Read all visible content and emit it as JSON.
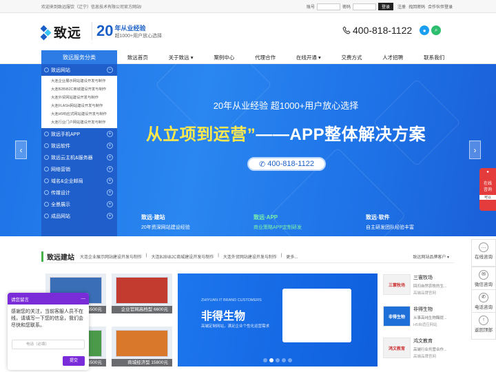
{
  "topbar": {
    "welcome": "欢迎来到致远服饮（辽宁）信息技术有限公司官方网站!",
    "user_label": "账号",
    "pass_label": "密码",
    "login_button": "登录",
    "links": [
      "注册",
      "找回密码",
      "合作伙伴登录"
    ]
  },
  "header": {
    "logo_text": "致远",
    "slogan_big": "20",
    "slogan_line1": "年从业经验",
    "slogan_line2": "超1000+用户放心选择",
    "phone": "400-818-1122"
  },
  "nav": {
    "category_label": "致远服务分类",
    "items": [
      "致远首页",
      "关于致远",
      "案例中心",
      "代理合作",
      "在线开通",
      "交费方式",
      "人才招聘",
      "联系我们"
    ]
  },
  "sidebar": {
    "first": "致远网站",
    "sub_items": [
      "大连企业展示网站建设开发与制作",
      "大连B2B\\B2C商城建设开发与制作",
      "大连外贸网站建设开发与制作",
      "大连FLASH网站建设开发与制作",
      "大连H5响应式网站建设开发与制作",
      "大连行业门户网站建设开发与制作"
    ],
    "items": [
      "致远手机APP",
      "致远软件",
      "致远云主机&服务器",
      "网络营销",
      "域名&企业邮局",
      "传媒设计",
      "全景展示",
      "成品网站"
    ]
  },
  "banner": {
    "subtitle": "20年从业经验    超1000+用户放心选择",
    "head_a": "从立项到运营”",
    "head_b": "——APP整体解决方案",
    "phone": "400-818-1122",
    "features": [
      {
        "title": "致远·建站",
        "desc": "20年资深网站建设经验"
      },
      {
        "title": "致远·APP",
        "desc": "商业策略APP定制研发"
      },
      {
        "title": "致远·软件",
        "desc": "自主研发团队经验丰富"
      }
    ]
  },
  "section": {
    "title": "致远建站",
    "links": [
      "大连企业展示网站建设开发与制作",
      "|",
      "大连B2B\\B2C商城建设开发与制作",
      "|",
      "大连外贸网站建设开发与制作",
      "|",
      "更多..."
    ],
    "right": "致远网站品牌客户 ▾"
  },
  "cases": [
    "6500元",
    "企业官网高档型 6600元",
    "6500元",
    "商城经济型 15800元"
  ],
  "bigcase": {
    "en": "ZHIYUAN IT BRAND CUSTOMERS",
    "cn": "非得生物",
    "desc": "高端定制网站，满足企业个性化运营需求"
  },
  "brands": [
    {
      "name": "三寰牧场",
      "desc": "回归自然农牧的生...",
      "tag": "高端品牌官网",
      "logo": "三寰牧场"
    },
    {
      "name": "非得生物",
      "desc": "从事高纯生物酶提...",
      "tag": "H5自适应网站",
      "logo": "非得生物"
    },
    {
      "name": "鸿文教育",
      "desc": "高端行业托管合作...",
      "tag": "高端品牌官网",
      "logo": "鸿文教育"
    }
  ],
  "right_side": [
    "在线咨询",
    "微信咨询",
    "电话咨询",
    "返回顶部"
  ],
  "redbox": {
    "l1": "在线",
    "l2": "咨询",
    "l3": "可以"
  },
  "chat": {
    "header": "请您留言",
    "message": "感谢您的关注，当前客服人员不在线，请填写一下您的信息，我们会尽快和您联系。",
    "placeholder": "电话（必填）",
    "send": "提交"
  }
}
